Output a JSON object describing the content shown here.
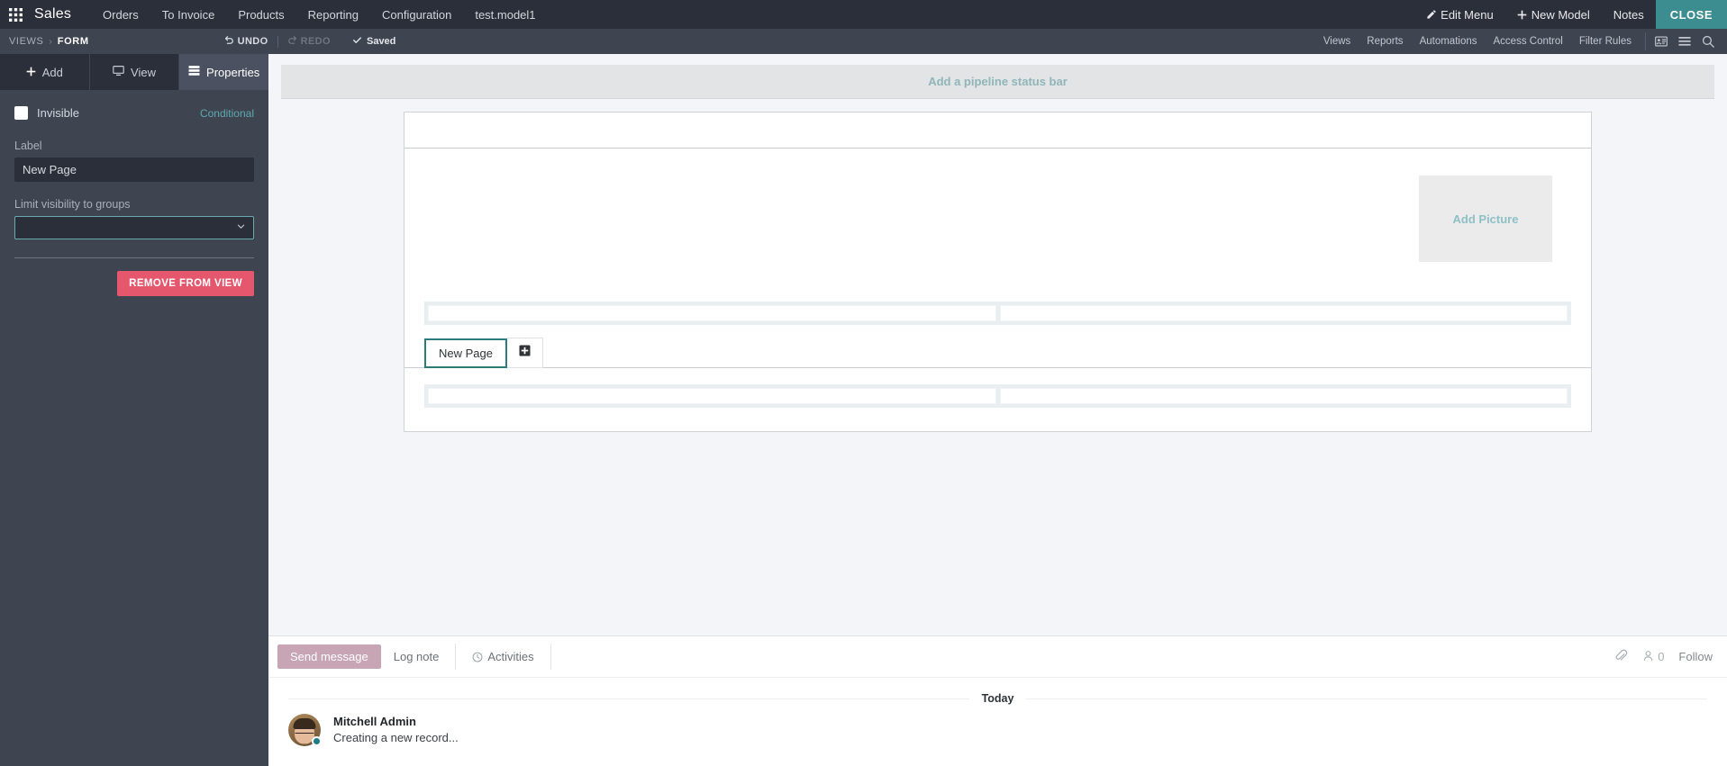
{
  "navbar": {
    "apps_icon": "apps-grid-icon",
    "brand": "Sales",
    "menus": [
      {
        "label": "Orders"
      },
      {
        "label": "To Invoice"
      },
      {
        "label": "Products"
      },
      {
        "label": "Reporting"
      },
      {
        "label": "Configuration"
      },
      {
        "label": "test.model1"
      }
    ],
    "right": [
      {
        "label": "Edit Menu",
        "icon": "pencil-icon"
      },
      {
        "label": "New Model",
        "icon": "plus-icon"
      },
      {
        "label": "Notes",
        "icon": ""
      }
    ],
    "close_label": "CLOSE"
  },
  "studiobar": {
    "breadcrumb_root": "VIEWS",
    "breadcrumb_sep": "›",
    "breadcrumb_current": "FORM",
    "undo_label": "UNDO",
    "redo_label": "REDO",
    "saved_label": "Saved",
    "saved_icon": "check-icon",
    "undo_icon": "undo-arrow-icon",
    "redo_icon": "redo-arrow-icon",
    "right_items": [
      {
        "label": "Views"
      },
      {
        "label": "Reports"
      },
      {
        "label": "Automations"
      },
      {
        "label": "Access Control"
      },
      {
        "label": "Filter Rules"
      }
    ],
    "icons": [
      {
        "name": "kanban-view-icon"
      },
      {
        "name": "list-view-icon"
      },
      {
        "name": "search-icon"
      }
    ]
  },
  "sidebar": {
    "tabs": [
      {
        "label": "Add",
        "icon": "plus-icon",
        "active": false
      },
      {
        "label": "View",
        "icon": "monitor-icon",
        "active": false
      },
      {
        "label": "Properties",
        "icon": "properties-list-icon",
        "active": true
      }
    ],
    "invisible_label": "Invisible",
    "invisible_checked": false,
    "conditional_link": "Conditional",
    "label_field_label": "Label",
    "label_field_value": "New Page",
    "label_field_placeholder": "",
    "groups_field_label": "Limit visibility to groups",
    "groups_field_value": "",
    "groups_field_placeholder": "",
    "remove_button": "REMOVE FROM VIEW",
    "remove_button_color": "#e4576d"
  },
  "main": {
    "status_bar_placeholder": "Add a pipeline status bar",
    "add_picture_label": "Add Picture",
    "notebook": {
      "tabs": [
        {
          "label": "New Page",
          "active": true
        }
      ],
      "add_tab_icon": "plus-square-icon"
    }
  },
  "chatter": {
    "send_message": "Send message",
    "log_note": "Log note",
    "activities": "Activities",
    "activities_icon": "clock-icon",
    "attachment_icon": "paperclip-icon",
    "followers_icon": "user-icon",
    "followers_count": "0",
    "follow_label": "Follow",
    "date_separator": "Today",
    "messages": [
      {
        "author": "Mitchell Admin",
        "text": "Creating a new record...",
        "avatar": "user-avatar"
      }
    ]
  },
  "colors": {
    "accent_teal": "#3c8d8f",
    "navbar_bg": "#2b2f3a",
    "sidebar_bg": "#3f4451",
    "danger": "#e4576d",
    "tab_active_border": "#2d7b7e"
  }
}
